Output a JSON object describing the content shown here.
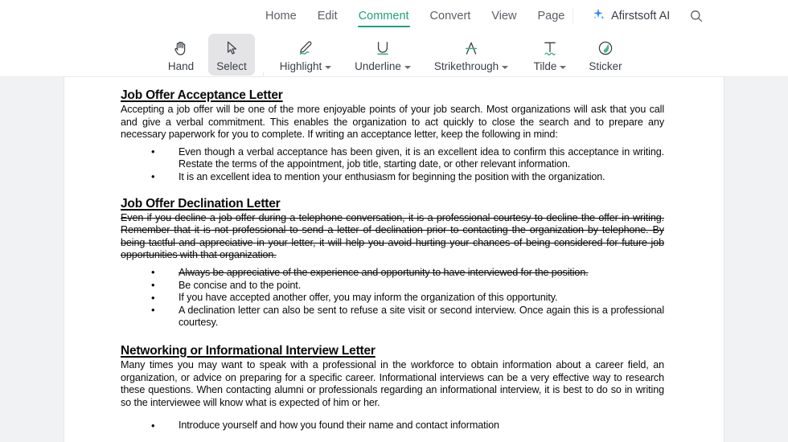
{
  "menubar": {
    "tabs": [
      {
        "label": "Home",
        "active": false
      },
      {
        "label": "Edit",
        "active": false
      },
      {
        "label": "Comment",
        "active": true
      },
      {
        "label": "Convert",
        "active": false
      },
      {
        "label": "View",
        "active": false
      },
      {
        "label": "Page",
        "active": false
      }
    ],
    "ai_label": "Afirstsoft AI",
    "search_icon": "search-icon",
    "sparkle_icon": "sparkle-icon"
  },
  "toolbar": {
    "tools": [
      {
        "label": "Hand",
        "icon": "hand-icon",
        "has_caret": false,
        "active": false
      },
      {
        "label": "Select",
        "icon": "cursor-arrow-icon",
        "has_caret": false,
        "active": true
      },
      {
        "label": "Highlight",
        "icon": "highlight-pen-icon",
        "has_caret": true,
        "active": false
      },
      {
        "label": "Underline",
        "icon": "underline-icon",
        "has_caret": true,
        "active": false
      },
      {
        "label": "Strikethrough",
        "icon": "strikethrough-icon",
        "has_caret": true,
        "active": false
      },
      {
        "label": "Tilde",
        "icon": "tilde-icon",
        "has_caret": true,
        "active": false
      },
      {
        "label": "Sticker",
        "icon": "sticker-icon",
        "has_caret": false,
        "active": false
      }
    ]
  },
  "colors": {
    "accent_green": "#22a07a",
    "icon_dark": "#3a3f46",
    "active_tool_bg": "#e4e4e7",
    "canvas_bg": "#f1f2f3",
    "page_bg": "#ffffff",
    "annotation_strikethrough": "#0c0c0c"
  },
  "document": {
    "section1": {
      "heading": "Job Offer Acceptance Letter",
      "paragraph": "Accepting a job offer will be one of the more enjoyable points of your job search.  Most organizations will ask that you call and give a verbal commitment.  This enables the organization to act quickly to close the search and to prepare any necessary paperwork for you to complete.  If writing an acceptance letter, keep the following in mind:",
      "bullets": [
        "Even though a verbal acceptance has been given, it is an excellent idea to confirm this acceptance in writing.  Restate the terms of the appointment, job title, starting date, or other relevant information.",
        "It is an excellent idea to mention your enthusiasm for beginning the position with the organization."
      ]
    },
    "section2": {
      "heading": "Job Offer Declination Letter",
      "paragraph": "Even if you decline a job offer during a telephone conversation, it is a professional courtesy to decline the offer in writing.  Remember that it is not professional to send a letter of declination prior to contacting the organization by telephone. By being tactful and appreciative in your letter, it will help you avoid hurting your chances of being considered for future job opportunities with that organization.",
      "paragraph_annotation": "strikethrough",
      "bullets": [
        {
          "text": "Always be appreciative of the experience and opportunity to have interviewed for the position.",
          "annotation": "strikethrough"
        },
        {
          "text": "Be concise and to the point.",
          "annotation": "none"
        },
        {
          "text": "If you have accepted another offer, you may inform the organization of this opportunity.",
          "annotation": "none"
        },
        {
          "text": "A declination letter can also be sent to refuse a site visit or second interview. Once again this is a professional courtesy.",
          "annotation": "none"
        }
      ]
    },
    "section3": {
      "heading": "Networking or Informational Interview Letter",
      "paragraph": "Many times you may want to speak with a professional in the workforce to obtain information about a career field, an organization, or advice on preparing for a specific career. Informational interviews can be a very effective way to research these questions.  When contacting alumni or professionals regarding an informational interview, it is best to do so in writing so the interviewee will know what is expected of him or her.",
      "clipped_bullet": "Introduce yourself and how you found their name and contact information"
    }
  }
}
